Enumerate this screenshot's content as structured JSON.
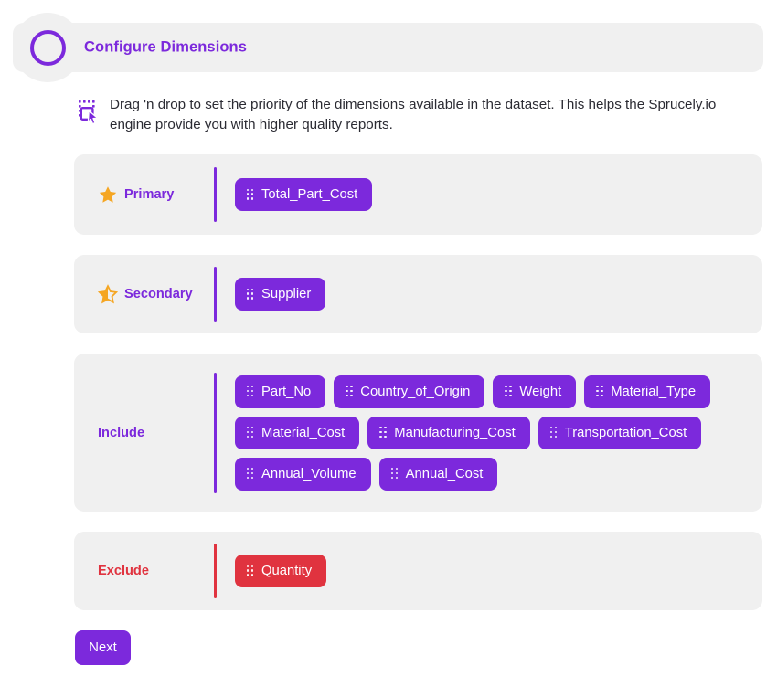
{
  "header": {
    "title": "Configure Dimensions",
    "ring_icon": "circle-outline-icon",
    "accent_color": "#7c29dc"
  },
  "description": {
    "icon": "drag-select-cursor-icon",
    "text": "Drag 'n drop to set the priority of the dimensions available in the dataset. This helps the Sprucely.io engine provide you with higher quality reports."
  },
  "colors": {
    "purple": "#7c29dc",
    "red": "#e0333f",
    "star_orange": "#f5a623",
    "panel_gray": "#f0f0f0",
    "page_background": "#ffffff"
  },
  "sections": [
    {
      "key": "primary",
      "label": "Primary",
      "icon": "star-filled-icon",
      "divider_color": "#7c29dc",
      "pills": [
        {
          "label": "Total_Part_Cost",
          "handle_icon": "drag-handle-icon",
          "variant": "purple"
        }
      ]
    },
    {
      "key": "secondary",
      "label": "Secondary",
      "icon": "star-half-icon",
      "divider_color": "#7c29dc",
      "pills": [
        {
          "label": "Supplier",
          "handle_icon": "drag-handle-icon",
          "variant": "purple"
        }
      ]
    },
    {
      "key": "include",
      "label": "Include",
      "icon": null,
      "divider_color": "#7c29dc",
      "pills": [
        {
          "label": "Part_No",
          "handle_icon": "drag-handle-icon",
          "variant": "purple"
        },
        {
          "label": "Country_of_Origin",
          "handle_icon": "drag-handle-icon",
          "variant": "purple"
        },
        {
          "label": "Weight",
          "handle_icon": "drag-handle-icon",
          "variant": "purple"
        },
        {
          "label": "Material_Type",
          "handle_icon": "drag-handle-icon",
          "variant": "purple"
        },
        {
          "label": "Material_Cost",
          "handle_icon": "drag-handle-icon",
          "variant": "purple"
        },
        {
          "label": "Manufacturing_Cost",
          "handle_icon": "drag-handle-icon",
          "variant": "purple"
        },
        {
          "label": "Transportation_Cost",
          "handle_icon": "drag-handle-icon",
          "variant": "purple"
        },
        {
          "label": "Annual_Volume",
          "handle_icon": "drag-handle-icon",
          "variant": "purple"
        },
        {
          "label": "Annual_Cost",
          "handle_icon": "drag-handle-icon",
          "variant": "purple"
        }
      ]
    },
    {
      "key": "exclude",
      "label": "Exclude",
      "icon": null,
      "divider_color": "#e0333f",
      "pills": [
        {
          "label": "Quantity",
          "handle_icon": "drag-handle-icon",
          "variant": "red"
        }
      ]
    }
  ],
  "footer": {
    "next_label": "Next"
  }
}
